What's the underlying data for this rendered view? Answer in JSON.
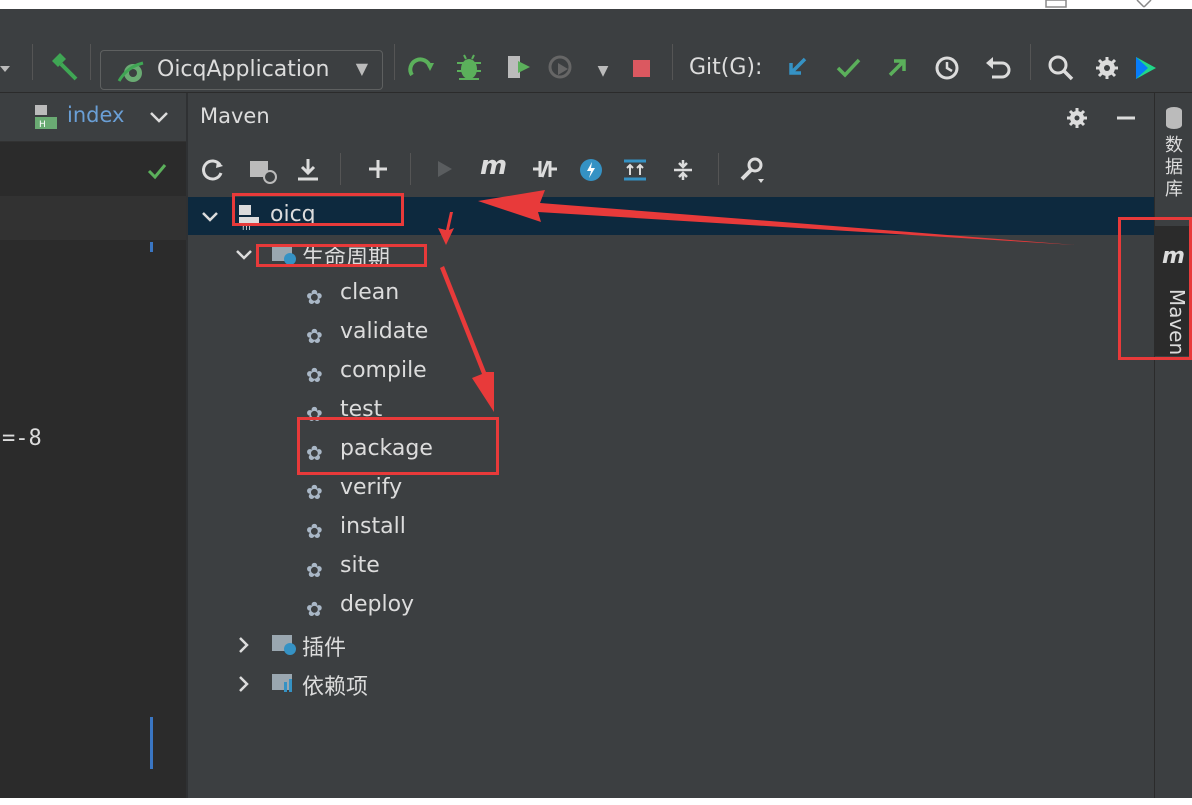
{
  "toolbar": {
    "run_config_label": "OicqApplication",
    "git_label": "Git(G):"
  },
  "editor": {
    "tab_label": "index",
    "code_fragment": "=-8"
  },
  "maven": {
    "panel_title": "Maven",
    "project": "oicq",
    "lifecycle_label": "生命周期",
    "goals": [
      "clean",
      "validate",
      "compile",
      "test",
      "package",
      "verify",
      "install",
      "site",
      "deploy"
    ],
    "plugins_label": "插件",
    "dependencies_label": "依赖项"
  },
  "sidebar": {
    "database_label": "数据库",
    "maven_label": "Maven"
  },
  "colors": {
    "background": "#3c3f41",
    "editor_background": "#2b2b2b",
    "selection": "#0d293e",
    "annotation_red": "#e83a3a",
    "text": "#dcdcdc"
  }
}
